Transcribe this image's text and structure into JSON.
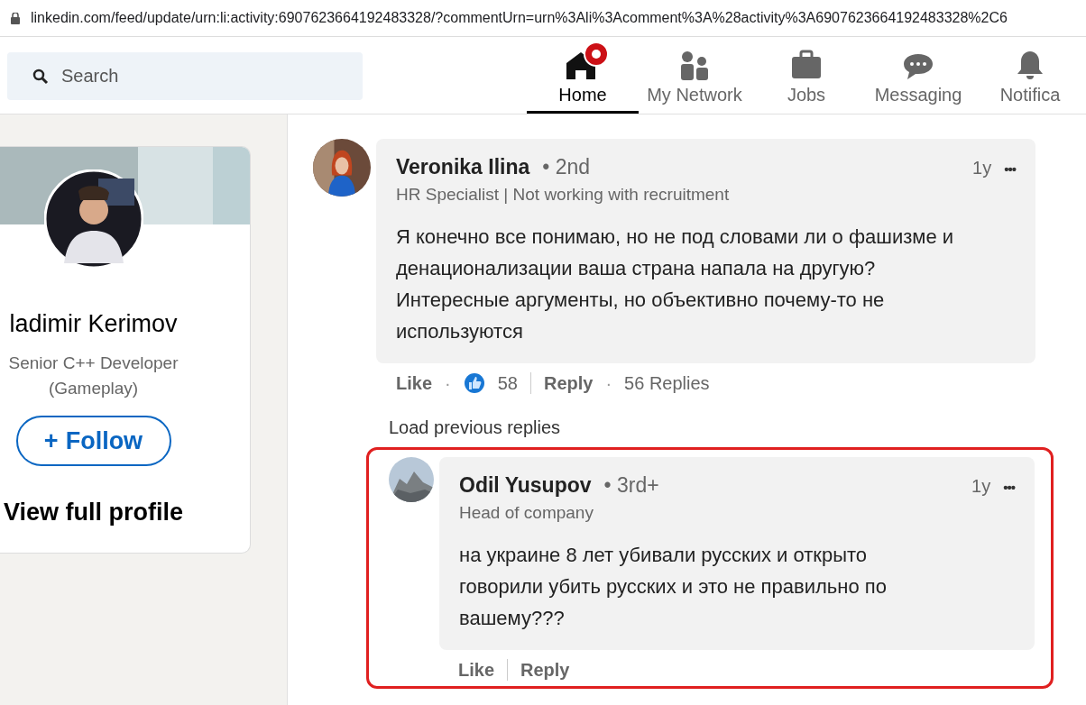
{
  "address_bar": {
    "url": "linkedin.com/feed/update/urn:li:activity:6907623664192483328/?commentUrn=urn%3Ali%3Acomment%3A%28activity%3A6907623664192483328%2C6"
  },
  "search": {
    "placeholder": "Search"
  },
  "nav": [
    {
      "kind": "home",
      "label": "Home",
      "selected": true,
      "badge": true
    },
    {
      "kind": "network",
      "label": "My Network",
      "selected": false,
      "badge": false
    },
    {
      "kind": "jobs",
      "label": "Jobs",
      "selected": false,
      "badge": false
    },
    {
      "kind": "messaging",
      "label": "Messaging",
      "selected": false,
      "badge": false
    },
    {
      "kind": "bell",
      "label": "Notifica",
      "selected": false,
      "badge": false
    }
  ],
  "profile": {
    "name": "ladimir Kerimov",
    "headline": "Senior C++ Developer (Gameplay)",
    "follow": "Follow",
    "follow_icon": "+",
    "view": "View full profile"
  },
  "comment": {
    "name": "Veronika Ilina",
    "degree": "• 2nd",
    "headline": "HR Specialist | Not working with recruitment",
    "time": "1y",
    "more": "•••",
    "text": "Я конечно все понимаю, но не под словами ли о фашизме и денационализации ваша страна напала на другую? Интересные аргументы, но объективно почему-то не используются",
    "like": "Like",
    "dot": "·",
    "reactions": "58",
    "reply": "Reply",
    "dot2": "·",
    "replies": "56 Replies"
  },
  "load_previous": "Load previous replies",
  "reply": {
    "name": "Odil Yusupov",
    "degree": "• 3rd+",
    "headline": "Head of company",
    "time": "1y",
    "more": "•••",
    "text": "на украине 8 лет убивали русских и открыто говорили убить русских и это не правильно по вашему???",
    "like": "Like",
    "reply": "Reply",
    "highlighted": true
  }
}
